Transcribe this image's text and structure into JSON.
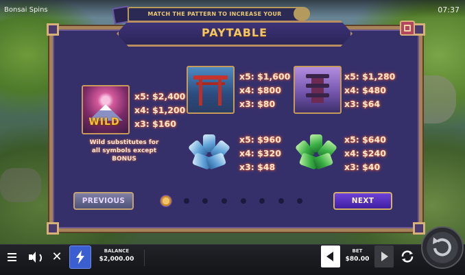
{
  "app": {
    "title": "Bonsai Spins",
    "clock": "07:37"
  },
  "banner": {
    "text": "MATCH THE PATTERN TO INCREASE YOUR"
  },
  "paytable": {
    "title": "PAYTABLE",
    "symbols": [
      {
        "name": "wild",
        "label": "WILD",
        "pays": [
          "x5: $2,400",
          "x4: $1,200",
          "x3: $160"
        ],
        "note": "Wild substitutes for all symbols except BONUS"
      },
      {
        "name": "torii-gate",
        "pays": [
          "x5: $1,600",
          "x4: $800",
          "x3: $80"
        ]
      },
      {
        "name": "pagoda",
        "pays": [
          "x5: $1,280",
          "x4: $480",
          "x3: $64"
        ]
      },
      {
        "name": "blue-crystal",
        "pays": [
          "x5: $960",
          "x4: $320",
          "x3: $48"
        ]
      },
      {
        "name": "green-crystal",
        "pays": [
          "x5: $640",
          "x4: $240",
          "x3: $40"
        ]
      }
    ],
    "previous_label": "PREVIOUS",
    "next_label": "NEXT",
    "pagination": {
      "current": 1,
      "total": 8
    }
  },
  "bottom_bar": {
    "balance_label": "BALANCE",
    "balance_value": "$2,000.00",
    "bet_label": "BET",
    "bet_value": "$80.00",
    "icons": [
      "menu-icon",
      "sound-icon",
      "close-icon",
      "turbo-icon",
      "bet-decrease-icon",
      "bet-increase-icon",
      "autoplay-icon",
      "spin-icon"
    ]
  },
  "colors": {
    "panel": "#36306a",
    "frame": "#a8835a",
    "title": "#f3c664",
    "next_button": "#5a33c6",
    "turbo": "#3b5fd0"
  }
}
